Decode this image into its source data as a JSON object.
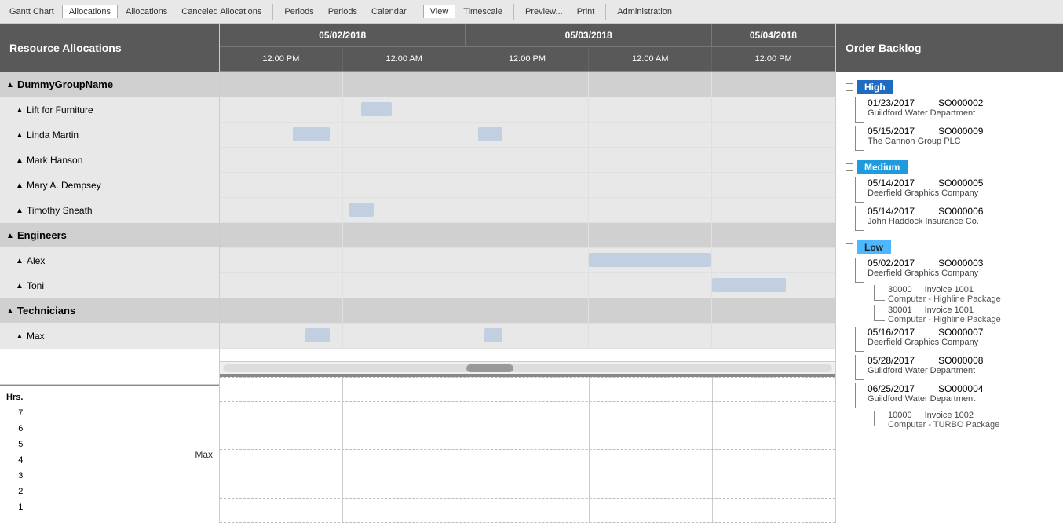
{
  "toolbar": {
    "buttons": [
      {
        "id": "gantt-chart",
        "label": "Gantt Chart"
      },
      {
        "id": "allocations1",
        "label": "Allocations",
        "active": true
      },
      {
        "id": "allocations2",
        "label": "Allocations"
      },
      {
        "id": "canceled",
        "label": "Canceled Allocations"
      },
      {
        "id": "periods1",
        "label": "Periods"
      },
      {
        "id": "periods2",
        "label": "Periods"
      },
      {
        "id": "calendar",
        "label": "Calendar"
      },
      {
        "id": "view",
        "label": "View",
        "active": true
      },
      {
        "id": "timescale",
        "label": "Timescale"
      },
      {
        "id": "preview",
        "label": "Preview..."
      },
      {
        "id": "print",
        "label": "Print"
      },
      {
        "id": "administration",
        "label": "Administration"
      }
    ]
  },
  "sidebar": {
    "title": "Resource Allocations",
    "groups": [
      {
        "name": "DummyGroupName",
        "children": [
          "Lift for Furniture",
          "Linda Martin",
          "Mark Hanson",
          "Mary A. Dempsey",
          "Timothy Sneath"
        ]
      },
      {
        "name": "Engineers",
        "children": [
          "Alex",
          "Toni"
        ]
      },
      {
        "name": "Technicians",
        "children": [
          "Max"
        ]
      }
    ]
  },
  "gantt": {
    "dates": [
      {
        "date": "05/02/2018",
        "colspan": 2
      },
      {
        "date": "05/03/2018",
        "colspan": 2
      },
      {
        "date": "05/04/2018",
        "colspan": 1
      }
    ],
    "times": [
      "12:00 PM",
      "12:00 AM",
      "12:00 PM",
      "12:00 AM",
      "12:00 PM"
    ]
  },
  "chart": {
    "label": "Hrs.",
    "yAxis": [
      "7",
      "6",
      "5",
      "4",
      "3",
      "2",
      "1"
    ],
    "name": "Max"
  },
  "orderBacklog": {
    "title": "Order Backlog",
    "priorities": [
      {
        "level": "High",
        "orders": [
          {
            "date": "01/23/2017",
            "so": "SO000002",
            "company": "Guildford Water Department",
            "subItems": []
          },
          {
            "date": "05/15/2017",
            "so": "SO000009",
            "company": "The Cannon Group PLC",
            "subItems": []
          }
        ]
      },
      {
        "level": "Medium",
        "orders": [
          {
            "date": "05/14/2017",
            "so": "SO000005",
            "company": "Deerfield Graphics Company",
            "subItems": []
          },
          {
            "date": "05/14/2017",
            "so": "SO000006",
            "company": "John Haddock Insurance Co.",
            "subItems": []
          }
        ]
      },
      {
        "level": "Low",
        "orders": [
          {
            "date": "05/02/2017",
            "so": "SO000003",
            "company": "Deerfield Graphics Company",
            "subItems": [
              {
                "id": "30000",
                "invoice": "Invoice 1001",
                "desc": "Computer - Highline Package"
              },
              {
                "id": "30001",
                "invoice": "Invoice 1001",
                "desc": "Computer - Highline Package"
              }
            ]
          },
          {
            "date": "05/16/2017",
            "so": "SO000007",
            "company": "Deerfield Graphics Company",
            "subItems": []
          },
          {
            "date": "05/28/2017",
            "so": "SO000008",
            "company": "Guildford Water Department",
            "subItems": []
          },
          {
            "date": "06/25/2017",
            "so": "SO000004",
            "company": "Guildford Water Department",
            "subItems": [
              {
                "id": "10000",
                "invoice": "Invoice 1002",
                "desc": "Computer - TURBO Package"
              }
            ]
          }
        ]
      }
    ]
  }
}
